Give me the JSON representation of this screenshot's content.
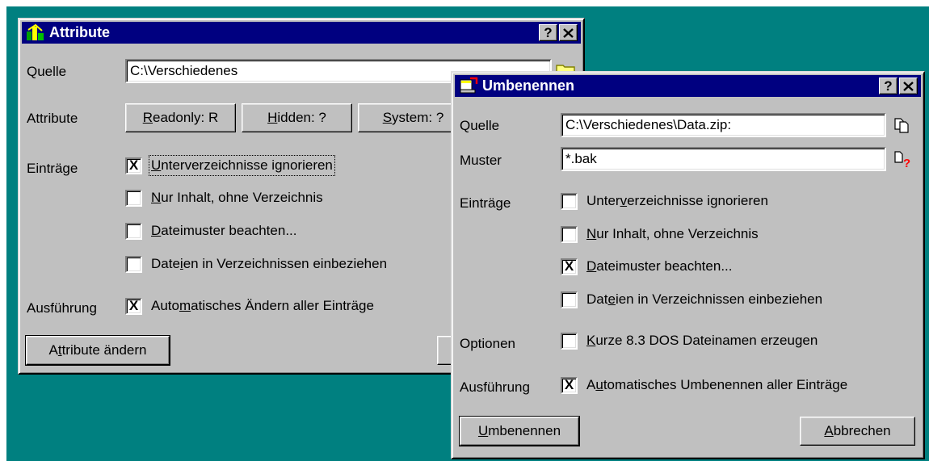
{
  "attribute_dialog": {
    "title": "Attribute",
    "help": "?",
    "close": "✕",
    "quelle_label": "Quelle",
    "quelle_value": "C:\\Verschiedenes",
    "attribute_label": "Attribute",
    "attr_buttons": [
      {
        "pre": "",
        "u": "R",
        "post": "eadonly: R"
      },
      {
        "pre": "",
        "u": "H",
        "post": "idden: ?"
      },
      {
        "pre": "",
        "u": "S",
        "post": "ystem: ?"
      }
    ],
    "eintraege_label": "Einträge",
    "options": [
      {
        "checked": true,
        "pre": "",
        "u": "U",
        "post": "nterverzeichnisse ignorieren"
      },
      {
        "checked": false,
        "pre": "",
        "u": "N",
        "post": "ur Inhalt, ohne Verzeichnis"
      },
      {
        "checked": false,
        "pre": "",
        "u": "D",
        "post": "ateimuster beachten..."
      },
      {
        "checked": false,
        "pre": "Date",
        "u": "i",
        "post": "en in Verzeichnissen einbeziehen"
      }
    ],
    "ausfuehrung_label": "Ausführung",
    "auto": {
      "checked": true,
      "pre": "Auto",
      "u": "m",
      "post": "atisches Ändern aller Einträge"
    },
    "action": {
      "pre": "A",
      "u": "t",
      "post": "tribute ändern"
    }
  },
  "umbenennen_dialog": {
    "title": "Umbenennen",
    "help": "?",
    "close": "✕",
    "quelle_label": "Quelle",
    "quelle_value": "C:\\Verschiedenes\\Data.zip:",
    "muster_label": "Muster",
    "muster_value": "*.bak",
    "eintraege_label": "Einträge",
    "options": [
      {
        "checked": false,
        "pre": "Unter",
        "u": "v",
        "post": "erzeichnisse ignorieren"
      },
      {
        "checked": false,
        "pre": "",
        "u": "N",
        "post": "ur Inhalt, ohne Verzeichnis"
      },
      {
        "checked": true,
        "pre": "",
        "u": "D",
        "post": "ateimuster beachten..."
      },
      {
        "checked": false,
        "pre": "Dat",
        "u": "e",
        "post": "ien in Verzeichnissen einbeziehen"
      }
    ],
    "optionen_label": "Optionen",
    "kurz": {
      "checked": false,
      "pre": "",
      "u": "K",
      "post": "urze 8.3 DOS Dateinamen erzeugen"
    },
    "ausfuehrung_label": "Ausführung",
    "auto": {
      "checked": true,
      "pre": "A",
      "u": "u",
      "post": "tomatisches Umbenennen aller Einträge"
    },
    "ok": {
      "pre": "",
      "u": "U",
      "post": "mbenennen"
    },
    "cancel": {
      "pre": "",
      "u": "A",
      "post": "bbrechen"
    },
    "check_mark": "X"
  }
}
